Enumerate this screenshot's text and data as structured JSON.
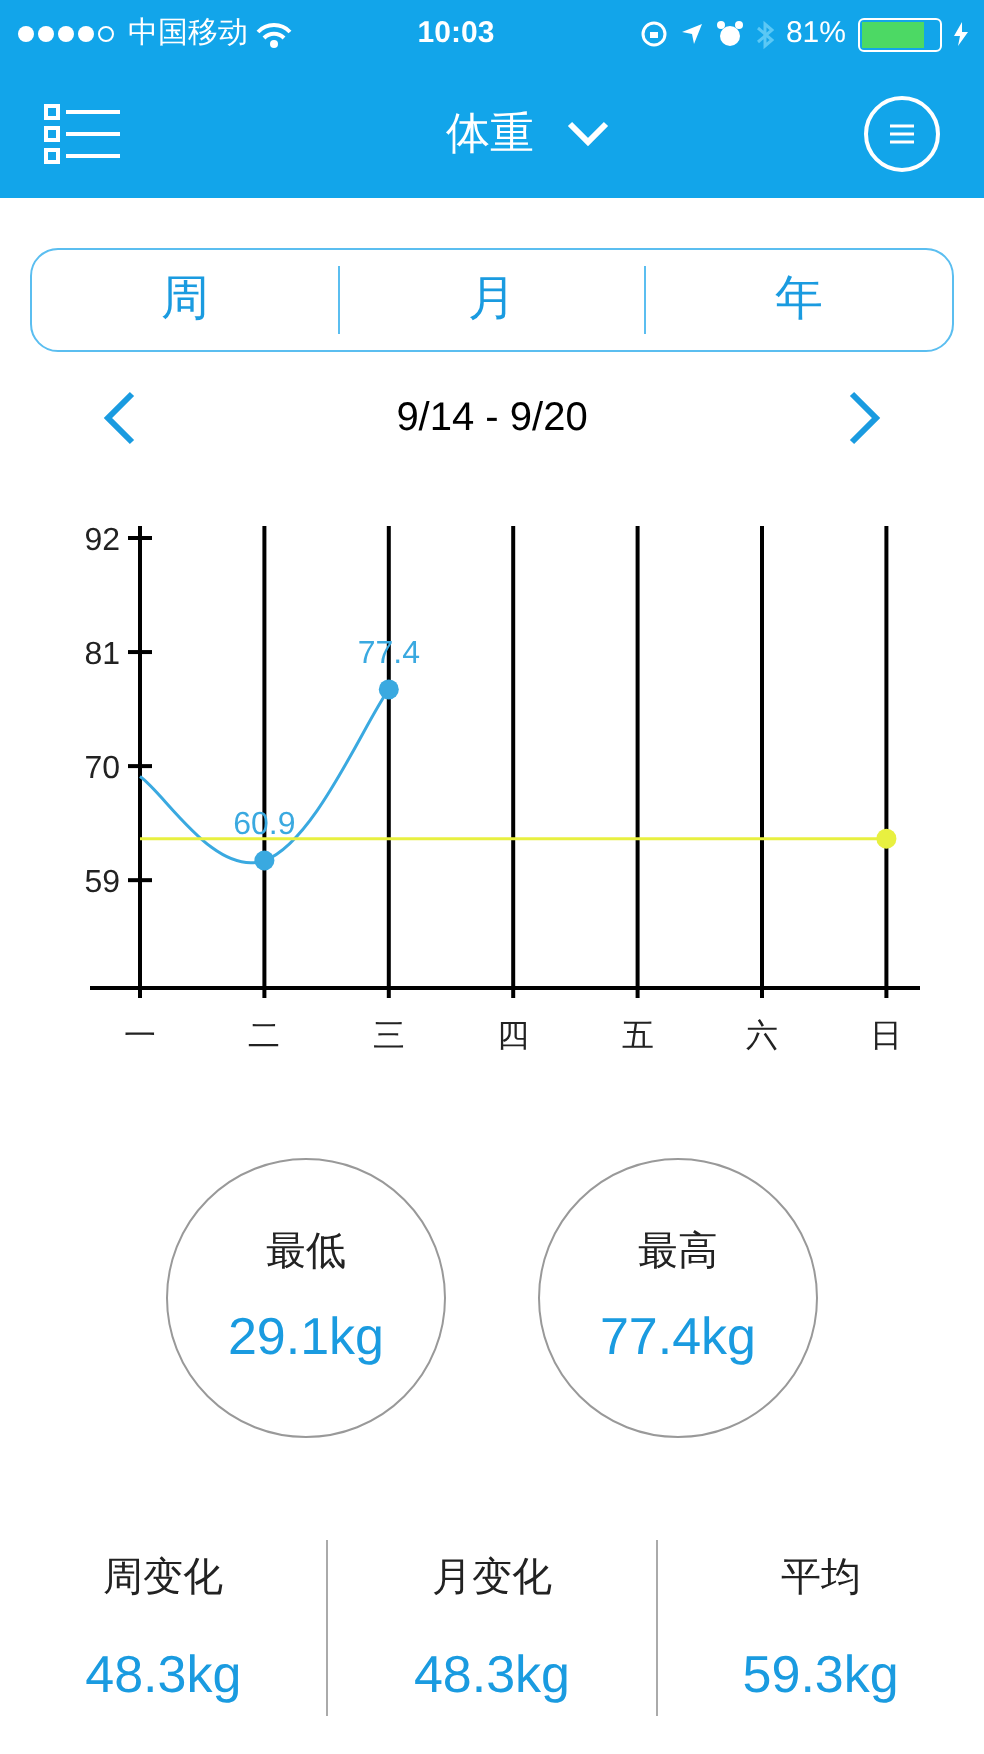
{
  "status_bar": {
    "carrier": "中国移动",
    "time": "10:03",
    "battery": "81%"
  },
  "nav": {
    "title": "体重"
  },
  "periods": [
    {
      "label": "周",
      "selected": false
    },
    {
      "label": "月",
      "selected": false
    },
    {
      "label": "年",
      "selected": false
    }
  ],
  "date_range": "9/14 - 9/20",
  "chart_data": {
    "type": "line",
    "categories": [
      "一",
      "二",
      "三",
      "四",
      "五",
      "六",
      "日"
    ],
    "ylim": [
      48.6,
      92
    ],
    "yticks": [
      59,
      70,
      81,
      92
    ],
    "grid": true,
    "series": [
      {
        "color": "#3aa9e0",
        "values": [
          69,
          60.9,
          77.4,
          null,
          null,
          null,
          null
        ]
      },
      {
        "color": "#e8f040",
        "values": [
          63,
          63,
          63,
          63,
          63,
          63,
          63
        ]
      }
    ],
    "value_labels": [
      null,
      "60.9",
      "77.4",
      null,
      null,
      null,
      null
    ]
  },
  "extremes": [
    {
      "label": "最低",
      "value": "29.1kg"
    },
    {
      "label": "最高",
      "value": "77.4kg"
    }
  ],
  "stats": [
    {
      "label": "周变化",
      "value": "48.3kg"
    },
    {
      "label": "月变化",
      "value": "48.3kg"
    },
    {
      "label": "平均",
      "value": "59.3kg"
    }
  ]
}
